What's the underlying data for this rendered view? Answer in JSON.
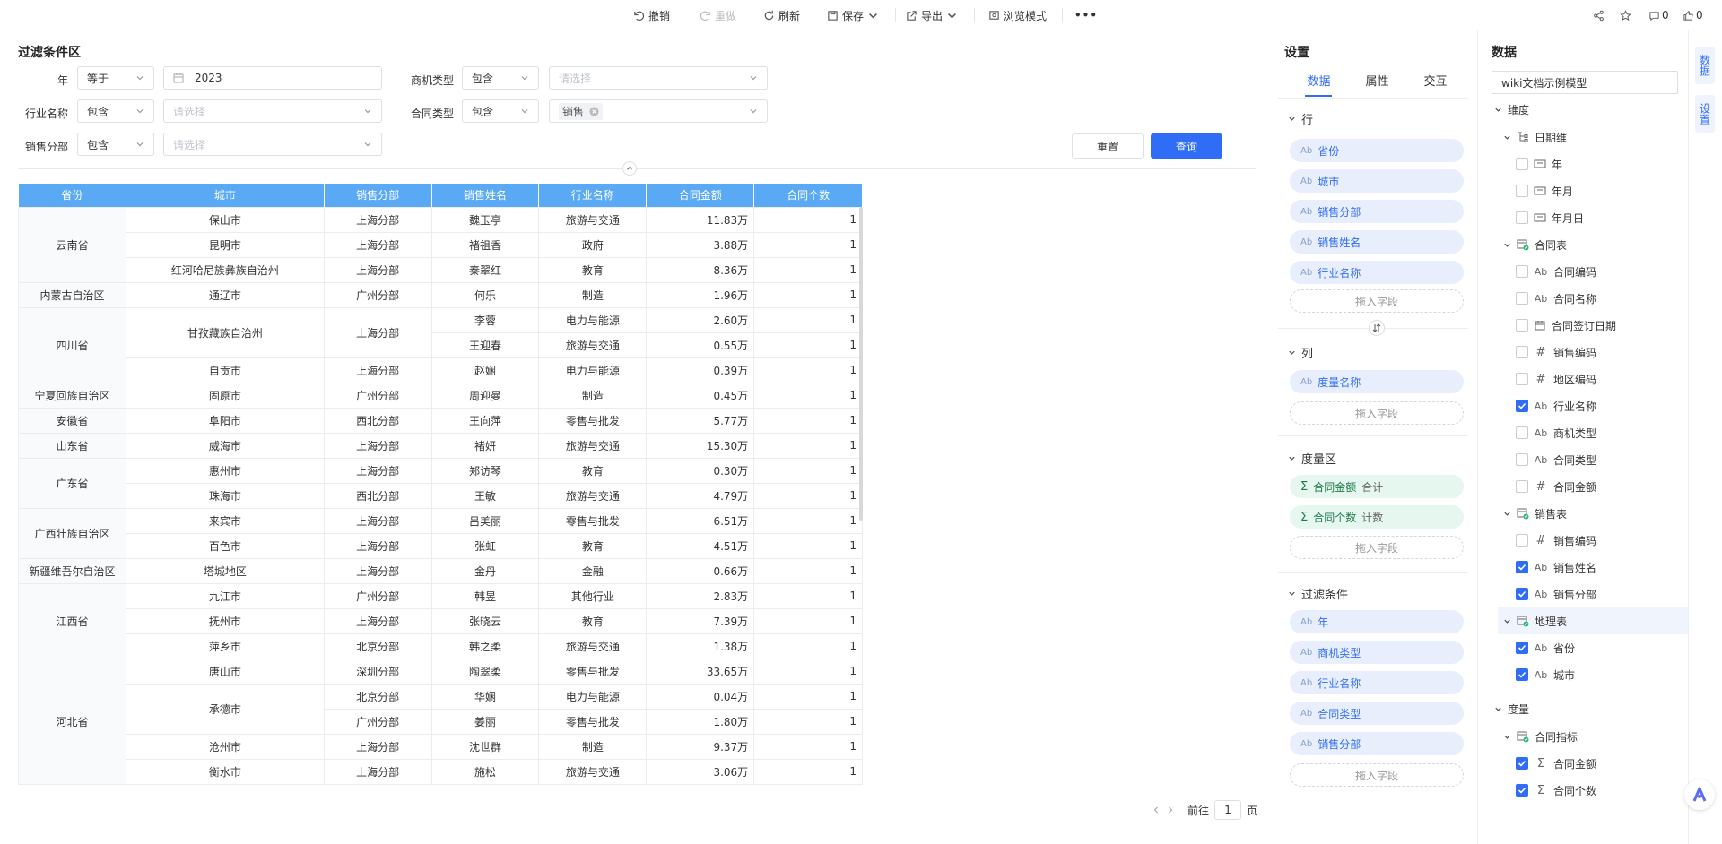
{
  "toolbar": {
    "undo": "撤销",
    "redo": "重做",
    "refresh": "刷新",
    "save": "保存",
    "export": "导出",
    "browse": "浏览模式",
    "more": "•••",
    "comments": "0",
    "likes": "0"
  },
  "filter": {
    "title": "过滤条件区",
    "year_label": "年",
    "year_op": "等于",
    "year_value": "2023",
    "opp_label": "商机类型",
    "opp_op": "包含",
    "opp_placeholder": "请选择",
    "industry_label": "行业名称",
    "industry_op": "包含",
    "industry_placeholder": "请选择",
    "contract_label": "合同类型",
    "contract_op": "包含",
    "contract_tag": "销售",
    "dept_label": "销售分部",
    "dept_op": "包含",
    "dept_placeholder": "请选择",
    "reset": "重置",
    "query": "查询"
  },
  "table": {
    "headers": [
      "省份",
      "城市",
      "销售分部",
      "销售姓名",
      "行业名称",
      "合同金额",
      "合同个数"
    ],
    "rows": [
      [
        "云南省",
        "保山市",
        "上海分部",
        "魏玉亭",
        "旅游与交通",
        "11.83万",
        "1"
      ],
      [
        "",
        "昆明市",
        "上海分部",
        "褚祖香",
        "政府",
        "3.88万",
        "1"
      ],
      [
        "",
        "红河哈尼族彝族自治州",
        "上海分部",
        "秦翠红",
        "教育",
        "8.36万",
        "1"
      ],
      [
        "内蒙古自治区",
        "通辽市",
        "广州分部",
        "何乐",
        "制造",
        "1.96万",
        "1"
      ],
      [
        "四川省",
        "甘孜藏族自治州",
        "上海分部",
        "李蓉",
        "电力与能源",
        "2.60万",
        "1"
      ],
      [
        "",
        "",
        "",
        "王迎春",
        "旅游与交通",
        "0.55万",
        "1"
      ],
      [
        "",
        "自贡市",
        "上海分部",
        "赵娴",
        "电力与能源",
        "0.39万",
        "1"
      ],
      [
        "宁夏回族自治区",
        "固原市",
        "广州分部",
        "周迎曼",
        "制造",
        "0.45万",
        "1"
      ],
      [
        "安徽省",
        "阜阳市",
        "西北分部",
        "王向萍",
        "零售与批发",
        "5.77万",
        "1"
      ],
      [
        "山东省",
        "威海市",
        "上海分部",
        "褚妍",
        "旅游与交通",
        "15.30万",
        "1"
      ],
      [
        "广东省",
        "惠州市",
        "上海分部",
        "郑访琴",
        "教育",
        "0.30万",
        "1"
      ],
      [
        "",
        "珠海市",
        "西北分部",
        "王敏",
        "旅游与交通",
        "4.79万",
        "1"
      ],
      [
        "广西壮族自治区",
        "来宾市",
        "上海分部",
        "吕美丽",
        "零售与批发",
        "6.51万",
        "1"
      ],
      [
        "",
        "百色市",
        "上海分部",
        "张虹",
        "教育",
        "4.51万",
        "1"
      ],
      [
        "新疆维吾尔自治区",
        "塔城地区",
        "上海分部",
        "金丹",
        "金融",
        "0.66万",
        "1"
      ],
      [
        "江西省",
        "九江市",
        "广州分部",
        "韩昱",
        "其他行业",
        "2.83万",
        "1"
      ],
      [
        "",
        "抚州市",
        "上海分部",
        "张晓云",
        "教育",
        "7.39万",
        "1"
      ],
      [
        "",
        "萍乡市",
        "北京分部",
        "韩之柔",
        "旅游与交通",
        "1.38万",
        "1"
      ],
      [
        "河北省",
        "唐山市",
        "深圳分部",
        "陶翠柔",
        "零售与批发",
        "33.65万",
        "1"
      ],
      [
        "",
        "承德市",
        "北京分部",
        "华娴",
        "电力与能源",
        "0.04万",
        "1"
      ],
      [
        "",
        "",
        "广州分部",
        "姜丽",
        "零售与批发",
        "1.80万",
        "1"
      ],
      [
        "",
        "沧州市",
        "上海分部",
        "沈世群",
        "制造",
        "9.37万",
        "1"
      ],
      [
        "",
        "衡水市",
        "上海分部",
        "施松",
        "旅游与交通",
        "3.06万",
        "1"
      ]
    ]
  },
  "pager": {
    "prefix": "前往",
    "page": "1",
    "suffix": "页"
  },
  "settings": {
    "title": "设置",
    "tabs": [
      "数据",
      "属性",
      "交互"
    ],
    "rows_label": "行",
    "rows": [
      "省份",
      "城市",
      "销售分部",
      "销售姓名",
      "行业名称"
    ],
    "cols_label": "列",
    "cols": [
      "度量名称"
    ],
    "measures_label": "度量区",
    "measures": [
      {
        "name": "合同金额",
        "agg": "合计"
      },
      {
        "name": "合同个数",
        "agg": "计数"
      }
    ],
    "filters_label": "过滤条件",
    "filters": [
      "年",
      "商机类型",
      "行业名称",
      "合同类型",
      "销售分部"
    ],
    "drop": "拖入字段"
  },
  "data_panel": {
    "title": "数据",
    "model": "wiki文档示例模型",
    "dim_label": "维度",
    "date_dim": "日期维",
    "date_fields": [
      "年",
      "年月",
      "年月日"
    ],
    "contract_table": "合同表",
    "contract_fields": [
      {
        "type": "Ab",
        "name": "合同编码",
        "checked": false
      },
      {
        "type": "Ab",
        "name": "合同名称",
        "checked": false
      },
      {
        "type": "date",
        "name": "合同签订日期",
        "checked": false
      },
      {
        "type": "#",
        "name": "销售编码",
        "checked": false
      },
      {
        "type": "#",
        "name": "地区编码",
        "checked": false
      },
      {
        "type": "Ab",
        "name": "行业名称",
        "checked": true
      },
      {
        "type": "Ab",
        "name": "商机类型",
        "checked": false
      },
      {
        "type": "Ab",
        "name": "合同类型",
        "checked": false
      },
      {
        "type": "#",
        "name": "合同金额",
        "checked": false
      }
    ],
    "sales_table": "销售表",
    "sales_fields": [
      {
        "type": "#",
        "name": "销售编码",
        "checked": false
      },
      {
        "type": "Ab",
        "name": "销售姓名",
        "checked": true
      },
      {
        "type": "Ab",
        "name": "销售分部",
        "checked": true
      }
    ],
    "geo_table": "地理表",
    "geo_fields": [
      {
        "type": "Ab",
        "name": "省份",
        "checked": true
      },
      {
        "type": "Ab",
        "name": "城市",
        "checked": true
      }
    ],
    "measure_label": "度量",
    "metric_group": "合同指标",
    "metrics": [
      {
        "type": "Σ",
        "name": "合同金额",
        "checked": true
      },
      {
        "type": "Σ",
        "name": "合同个数",
        "checked": true
      }
    ]
  },
  "side_tabs": [
    "数据",
    "设置"
  ],
  "colors": {
    "accent": "#2f6df6",
    "header": "#5aa9f5"
  }
}
